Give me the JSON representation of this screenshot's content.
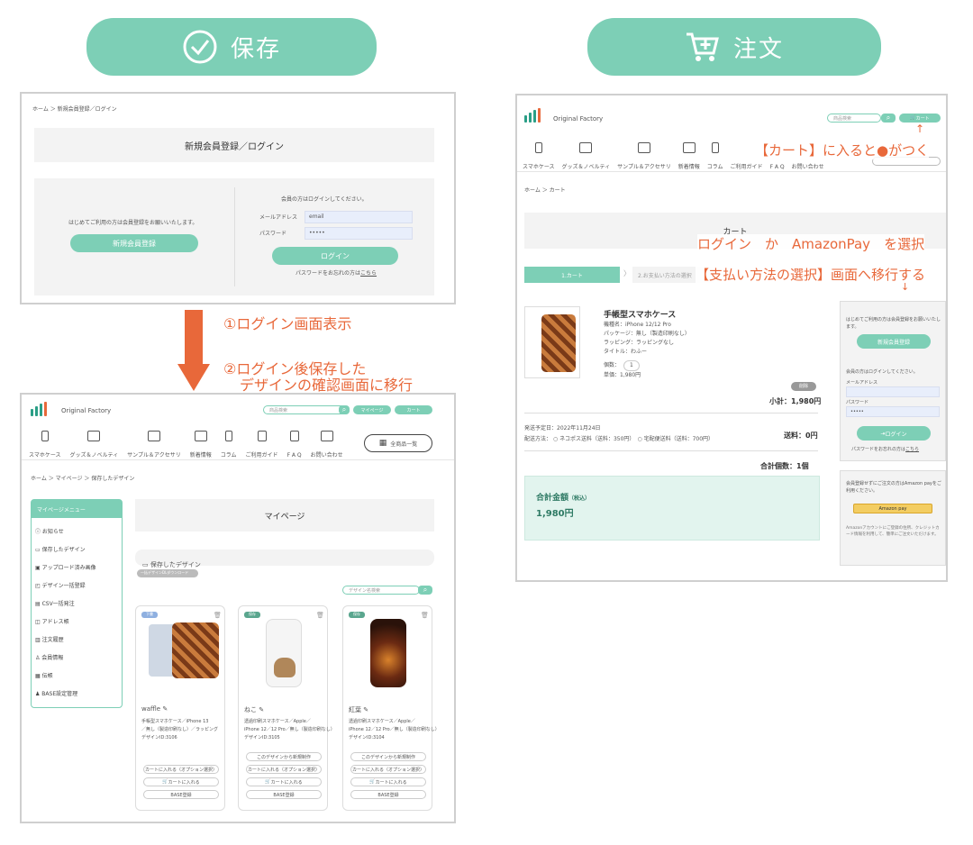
{
  "left": {
    "header": {
      "label": "保存",
      "icon": "check-circle-icon"
    },
    "login_screen": {
      "breadcrumb": "ホーム ＞ 新規会員登録／ログイン",
      "title": "新規会員登録／ログイン",
      "first_time_text": "はじめてご利用の方は会員登録をお願いいたします。",
      "register_button": "新規会員登録",
      "member_text": "会員の方はログインしてください。",
      "email_label": "メールアドレス",
      "email_value": "email",
      "password_label": "パスワード",
      "password_value": "•••••",
      "login_button": "ログイン",
      "forgot_text": "パスワードをお忘れの方は",
      "forgot_link": "こちら"
    },
    "annotations": {
      "step1": "①ログイン画面表示",
      "step2_line1": "②ログイン後保存した",
      "step2_line2": "デザインの確認画面に移行"
    },
    "mypage_screen": {
      "logo": "Original Factory",
      "search_placeholder": "商品検索",
      "mypage_button": "マイページ",
      "cart_button": "カート",
      "nav": [
        "スマホケース",
        "グッズ＆ノベルティ",
        "サンプル＆アクセサリ",
        "新着情報",
        "コラム",
        "ご利用ガイド",
        "F A Q",
        "お問い合わせ"
      ],
      "all_products_button": "全商品一覧",
      "breadcrumb": "ホーム ＞ マイページ ＞ 保存したデザイン",
      "sidebar_title": "マイページメニュー",
      "sidebar_items": [
        "お知らせ",
        "保存したデザイン",
        "アップロード済み画像",
        "デザイン一括登録",
        "CSV一括発注",
        "アドレス帳",
        "注文履歴",
        "会員情報",
        "伝帳",
        "BASE設定管理"
      ],
      "page_title": "マイページ",
      "section_title": "保存したデザイン",
      "bulk_download": "一括デザインDLダウンロード",
      "design_search_placeholder": "デザイン名検索",
      "cards": [
        {
          "badge": "下書",
          "name": "waffle",
          "desc1": "手帳型スマホケース／iPhone 13",
          "desc2": "／無し（製造印刷なし）／ラッピング",
          "desc3": "デザインID:3106"
        },
        {
          "badge": "保存",
          "name": "ねこ",
          "desc1": "透過印刷スマホケース／Apple／",
          "desc2": "iPhone 12／12 Pro／無し（製造印刷なし）",
          "desc3": "デザインID:3105"
        },
        {
          "badge": "保存",
          "name": "紅葉",
          "desc1": "透過印刷スマホケース／Apple／",
          "desc2": "iPhone 12／12 Pro／無し（製造印刷なし）",
          "desc3": "デザインID:3104"
        }
      ],
      "card_buttons": [
        "このデザインから新規制作",
        "カートに入れる（オプション選択）",
        "カートに入れる",
        "BASE登録"
      ]
    }
  },
  "right": {
    "header": {
      "label": "注文",
      "icon": "cart-add-icon"
    },
    "cart_screen": {
      "logo": "Original Factory",
      "search_placeholder": "商品検索",
      "cart_button": "カート",
      "nav": [
        "スマホケース",
        "グッズ＆ノベルティ",
        "サンプル＆アクセサリ",
        "新着情報",
        "コラム",
        "ご利用ガイド",
        "F A Q",
        "お問い合わせ"
      ],
      "breadcrumb": "ホーム ＞ カート",
      "title": "カート",
      "step1": "1.カート",
      "step2": "2.お支払い方法の選択",
      "product_name": "手帳型スマホケース",
      "product_specs": [
        "機種名：iPhone 12/12 Pro",
        "パッケージ：無し（製造印刷なし）",
        "ラッピング：ラッピングなし",
        "タイトル：わふー",
        "単価：1,980円"
      ],
      "qty_label": "個数：",
      "qty_value": "1",
      "delete_button": "削除",
      "subtotal": "小計：1,980円",
      "ship_date": "発送予定日：2022年11月24日",
      "ship_method_label": "配送方法：",
      "ship_option1": "ネコポス送料（送料：350円）",
      "ship_option2": "宅配便送料（送料：700円）",
      "shipping_fee": "送料：0円",
      "total_count": "合計個数：1個",
      "total_label": "合計金額",
      "total_tax": "（税込）",
      "total_value": "1,980円",
      "panel": {
        "first_text": "はじめてご利用の方は会員登録をお願いいたします。",
        "register_button": "新規会員登録",
        "member_text": "会員の方はログインしてください。",
        "email_label": "メールアドレス",
        "password_label": "パスワード",
        "password_value": "•••••",
        "login_button": "ログイン",
        "forgot_text": "パスワードをお忘れの方は",
        "forgot_link": "こちら",
        "amazon_text": "会員登録せずにご注文の方はAmazon payをご利用ください。",
        "amazon_button": "Amazon pay",
        "amazon_note": "Amazonアカウントにご登録の住所、クレジットカード情報を利用して、簡単にご注文いただけます。"
      }
    },
    "annotations": {
      "cart_dot": "【カート】に入ると●がつく",
      "login_select": "ログイン　か　AmazonPay　を選択",
      "payment_move": "【支払い方法の選択】画面へ移行する"
    }
  },
  "colors": {
    "accent": "#7dcfb6",
    "annotation": "#e8683a",
    "arrow": "#e8683a"
  }
}
